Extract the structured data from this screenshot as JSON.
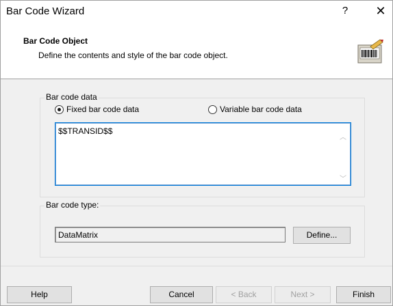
{
  "window": {
    "title": "Bar Code Wizard",
    "help_glyph": "?",
    "close_glyph": "✕"
  },
  "header": {
    "title": "Bar Code Object",
    "description": "Define the contents and style of the bar code object.",
    "icon": "barcode-printer-icon"
  },
  "barcode_data": {
    "group_label": "Bar code data",
    "fixed_label": "Fixed bar code data",
    "variable_label": "Variable bar code data",
    "selected": "fixed",
    "value": "$$TRANSID$$"
  },
  "barcode_type": {
    "group_label": "Bar code type:",
    "value": "DataMatrix",
    "define_label": "Define..."
  },
  "footer": {
    "help_label": "Help",
    "cancel_label": "Cancel",
    "back_label": "< Back",
    "next_label": "Next >",
    "finish_label": "Finish"
  },
  "colors": {
    "accent": "#0078d7",
    "dialog_bg": "#f0f0f0",
    "disabled_text": "#a0a0a0"
  }
}
